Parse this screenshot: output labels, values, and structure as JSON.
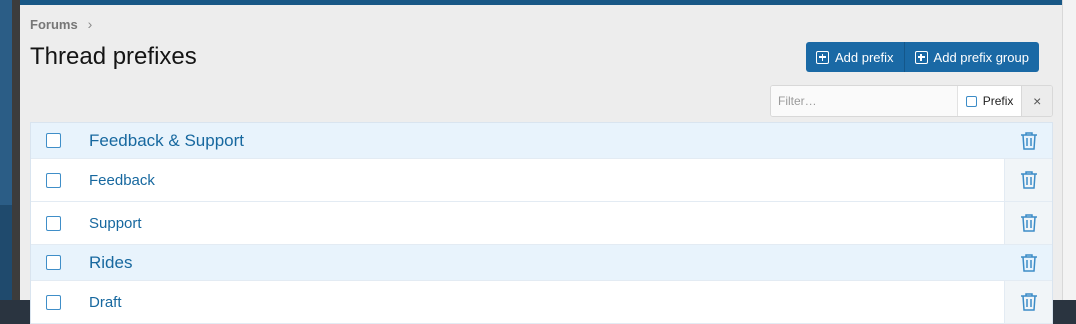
{
  "breadcrumb": {
    "parent": "Forums",
    "separator": "›"
  },
  "page": {
    "title": "Thread prefixes"
  },
  "actions": {
    "add_prefix": "Add prefix",
    "add_prefix_group": "Add prefix group"
  },
  "filter": {
    "placeholder": "Filter…",
    "prefix_toggle": "Prefix",
    "clear_icon": "×"
  },
  "rows": [
    {
      "label": "Feedback & Support",
      "type": "group"
    },
    {
      "label": "Feedback",
      "type": "item"
    },
    {
      "label": "Support",
      "type": "item"
    },
    {
      "label": "Rides",
      "type": "group"
    },
    {
      "label": "Draft",
      "type": "item"
    }
  ],
  "colors": {
    "accent": "#1a69a5",
    "link": "#17689f",
    "group_bg": "#e8f3fc",
    "topbar": "#185886"
  }
}
